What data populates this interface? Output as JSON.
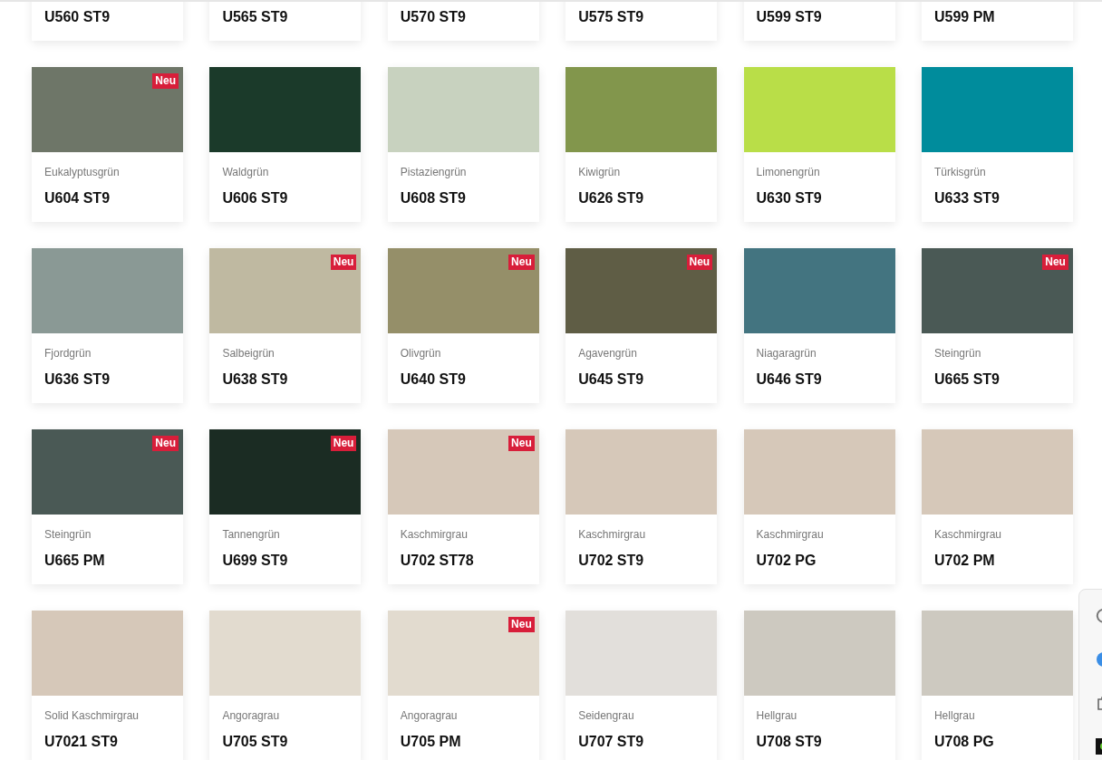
{
  "swatches": [
    {
      "code": "U560 ST9"
    },
    {
      "code": "U565 ST9"
    },
    {
      "code": "U570 ST9"
    },
    {
      "code": "U575 ST9"
    },
    {
      "code": "U599 ST9"
    },
    {
      "code": "U599 PM"
    },
    {
      "name": "Eukalyptusgrün",
      "code": "U604 ST9",
      "color": "#6e7668",
      "badge": "Neu"
    },
    {
      "name": "Waldgrün",
      "code": "U606 ST9",
      "color": "#1b3a2a"
    },
    {
      "name": "Pistaziengrün",
      "code": "U608 ST9",
      "color": "#c8d2bf"
    },
    {
      "name": "Kiwigrün",
      "code": "U626 ST9",
      "color": "#82964c"
    },
    {
      "name": "Limonengrün",
      "code": "U630 ST9",
      "color": "#b9de48"
    },
    {
      "name": "Türkisgrün",
      "code": "U633 ST9",
      "color": "#008c9c"
    },
    {
      "name": "Fjordgrün",
      "code": "U636 ST9",
      "color": "#8a9995"
    },
    {
      "name": "Salbeigrün",
      "code": "U638 ST9",
      "color": "#bfb9a1",
      "badge": "Neu"
    },
    {
      "name": "Olivgrün",
      "code": "U640 ST9",
      "color": "#958f69",
      "badge": "Neu"
    },
    {
      "name": "Agavengrün",
      "code": "U645 ST9",
      "color": "#5f5d45",
      "badge": "Neu"
    },
    {
      "name": "Niagaragrün",
      "code": "U646 ST9",
      "color": "#437480"
    },
    {
      "name": "Steingrün",
      "code": "U665 ST9",
      "color": "#4a5955",
      "badge": "Neu"
    },
    {
      "name": "Steingrün",
      "code": "U665 PM",
      "color": "#4a5955",
      "badge": "Neu"
    },
    {
      "name": "Tannengrün",
      "code": "U699 ST9",
      "color": "#1b2c23",
      "badge": "Neu"
    },
    {
      "name": "Kaschmirgrau",
      "code": "U702 ST78",
      "color": "#d6c8b9",
      "badge": "Neu"
    },
    {
      "name": "Kaschmirgrau",
      "code": "U702 ST9",
      "color": "#d6c8b9"
    },
    {
      "name": "Kaschmirgrau",
      "code": "U702 PG",
      "color": "#d6c8b9"
    },
    {
      "name": "Kaschmirgrau",
      "code": "U702 PM",
      "color": "#d6c8b9"
    },
    {
      "name": "Solid Kaschmirgrau",
      "code": "U7021 ST9",
      "color": "#d6c8b9"
    },
    {
      "name": "Angoragrau",
      "code": "U705 ST9",
      "color": "#e2dbcf"
    },
    {
      "name": "Angoragrau",
      "code": "U705 PM",
      "color": "#e2dbcf",
      "badge": "Neu"
    },
    {
      "name": "Seidengrau",
      "code": "U707 ST9",
      "color": "#e2dfdb"
    },
    {
      "name": "Hellgrau",
      "code": "U708 ST9",
      "color": "#cdc9c0"
    },
    {
      "name": "Hellgrau",
      "code": "U708 PG",
      "color": "#cdc9c0"
    }
  ]
}
